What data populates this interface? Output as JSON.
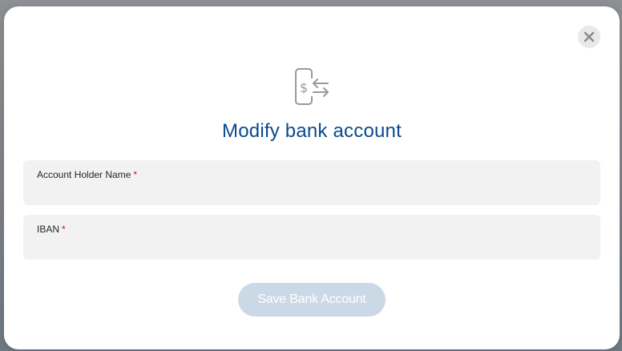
{
  "modal": {
    "title": "Modify bank account",
    "icon": "phone-money-transfer-icon",
    "close_icon": "close-icon"
  },
  "form": {
    "fields": [
      {
        "label": "Account Holder Name",
        "required_mark": "*",
        "value": "",
        "placeholder": ""
      },
      {
        "label": "IBAN",
        "required_mark": "*",
        "value": "",
        "placeholder": ""
      }
    ],
    "submit_label": "Save Bank Account"
  },
  "colors": {
    "title": "#0b4a8b",
    "required": "#c8102e",
    "field_bg": "#f2f2f2",
    "button_disabled_bg": "#cbd9e6",
    "icon_gray": "#9a9a9a"
  }
}
